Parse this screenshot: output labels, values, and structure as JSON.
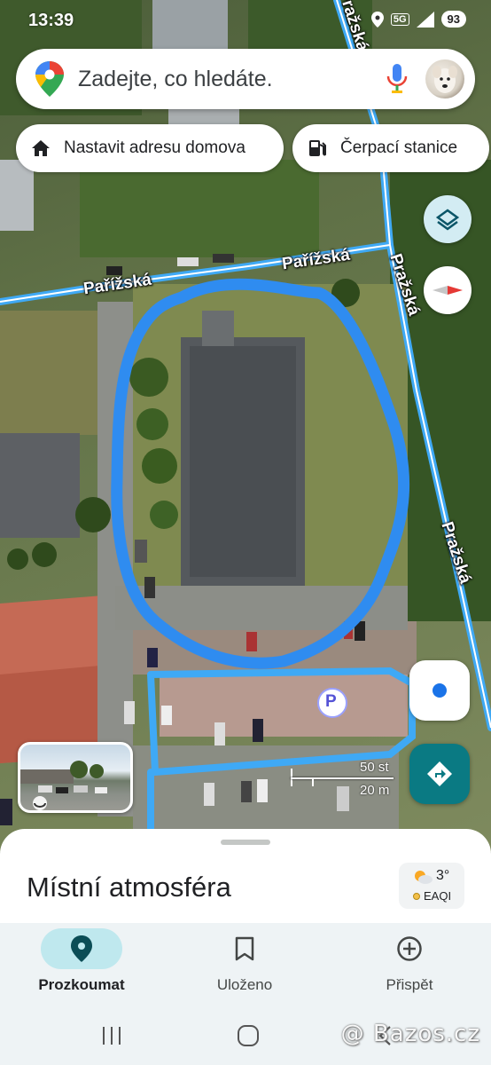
{
  "status_bar": {
    "time": "13:39",
    "network": "5G",
    "battery": "93"
  },
  "search": {
    "placeholder": "Zadejte, co hledáte."
  },
  "chips": [
    {
      "label": "Nastavit adresu domova",
      "icon": "home-icon"
    },
    {
      "label": "Čerpací stanice",
      "icon": "gas-station-icon"
    }
  ],
  "map": {
    "street_labels": [
      "Pařížská",
      "Pařížská",
      "Pražská",
      "Pražská",
      "Pražská"
    ],
    "parking_label": "P",
    "scale": {
      "imperial": "50 st",
      "metric": "20 m"
    },
    "colors": {
      "road_highlight": "#3fa9f5",
      "annotation": "#2f8cf0"
    }
  },
  "sheet": {
    "title": "Místní atmosféra",
    "weather": {
      "temp": "3°",
      "aqi": "EAQI"
    }
  },
  "bottom_nav": [
    {
      "label": "Prozkoumat",
      "icon": "explore-pin-icon",
      "active": true
    },
    {
      "label": "Uloženo",
      "icon": "bookmark-icon",
      "active": false
    },
    {
      "label": "Přispět",
      "icon": "add-circle-icon",
      "active": false
    }
  ],
  "watermark": "@ Bazos.cz"
}
